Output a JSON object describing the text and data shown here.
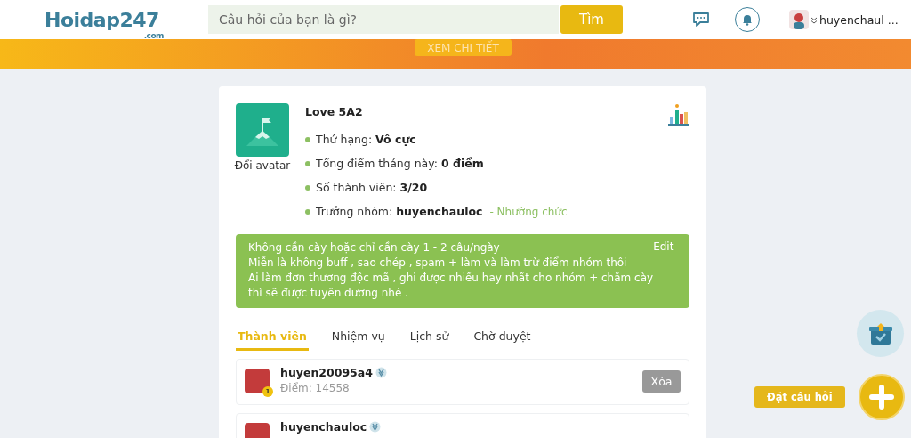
{
  "header": {
    "logo": "Hoidap247",
    "logo_sub": ".com",
    "search": {
      "placeholder": "Câu hỏi của bạn là gì?"
    },
    "search_button": "Tìm",
    "username": "huyenchaul ..."
  },
  "banner": {
    "button": "XEM CHI TIẾT"
  },
  "group": {
    "name": "Love 5A2",
    "avatar_label": "Đổi avatar",
    "stats": [
      {
        "label": "Thứ hạng:",
        "value": "Vô cực"
      },
      {
        "label": "Tổng điểm tháng này:",
        "value": "0 điểm"
      },
      {
        "label": "Số thành viên:",
        "value": "3/20"
      },
      {
        "label": "Trưởng nhóm:",
        "value": "huyenchauloc",
        "link": "- Nhường chức"
      }
    ],
    "description": [
      "Không cần cày hoặc chỉ cần cày 1 - 2 câu/ngày",
      "Miễn là không buff , sao chép , spam + làm  và làm trừ điểm nhóm thôi",
      "Ai làm đơn thương độc mã , ghi được nhiều hay nhất cho nhóm + chăm cày",
      "thì sẽ được tuyên dương nhé ."
    ],
    "edit": "Edit"
  },
  "tabs": [
    {
      "label": "Thành viên",
      "selected": true
    },
    {
      "label": "Nhiệm vụ",
      "selected": false
    },
    {
      "label": "Lịch sử",
      "selected": false
    },
    {
      "label": "Chờ duyệt",
      "selected": false
    }
  ],
  "members": [
    {
      "name": "huyen20095a4",
      "rank": "1",
      "points": "Điểm: 14558",
      "remove": "Xóa"
    },
    {
      "name": "huyenchauloc"
    }
  ],
  "fab": {
    "tooltip": "Đặt câu hỏi"
  }
}
